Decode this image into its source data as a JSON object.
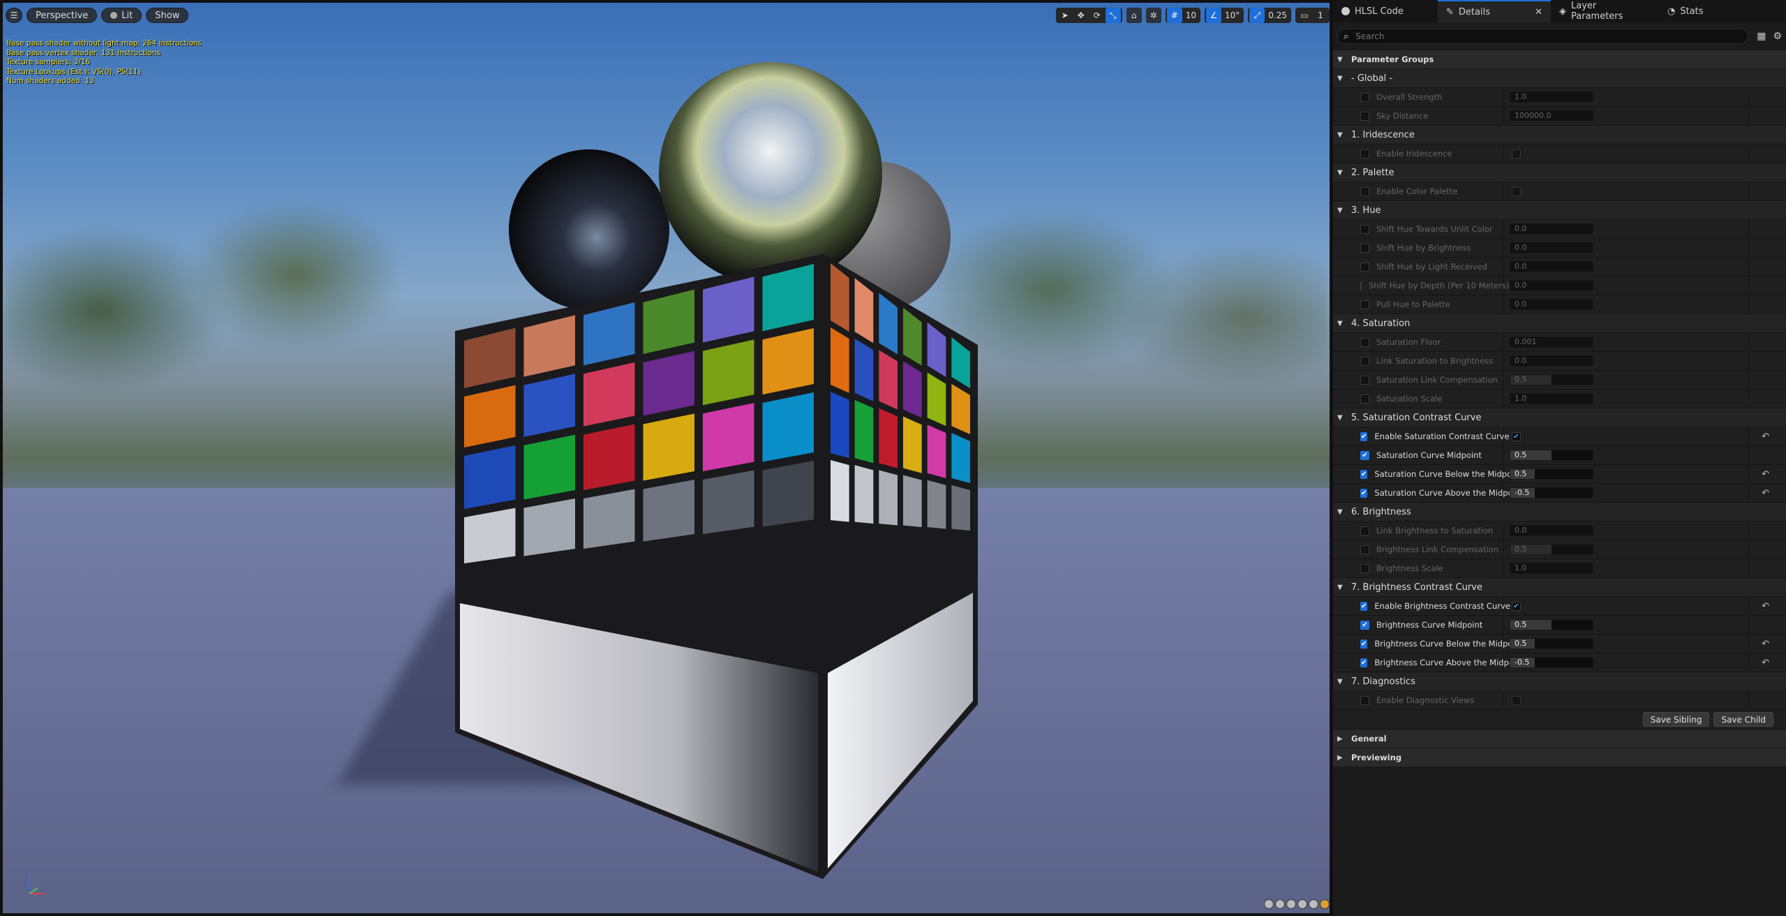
{
  "viewport": {
    "perspective_label": "Perspective",
    "lit_label": "Lit",
    "show_label": "Show",
    "grid_snap_value": "10",
    "rotation_snap_value": "10°",
    "scale_snap_value": "0.25",
    "camera_speed_value": "1",
    "stats": [
      "Base pass shader without light map: 264 instructions",
      "Base pass vertex shader: 131 instructions",
      "Texture samplers: 3/16",
      "Texture Lookups (Est.): VS(0), PS(11)",
      "Num shaders added: 13"
    ]
  },
  "tabs": [
    {
      "label": "HLSL Code",
      "icon": "ue-logo-icon"
    },
    {
      "label": "Details",
      "icon": "pencil-icon",
      "close": "✕"
    },
    {
      "label": "Layer Parameters",
      "icon": "layers-icon"
    },
    {
      "label": "Stats",
      "icon": "stats-icon"
    }
  ],
  "search": {
    "placeholder": "Search"
  },
  "details": {
    "parameter_groups": "Parameter Groups",
    "save_sibling": "Save Sibling",
    "save_child": "Save Child",
    "general": "General",
    "previewing": "Previewing",
    "groups": [
      {
        "name": "- Global -",
        "params": [
          {
            "label": "Overall Strength",
            "value": "1.0",
            "enabled": false,
            "fill": 0.0
          },
          {
            "label": "Sky Distance",
            "value": "100000.0",
            "enabled": false,
            "fill": 0.0
          }
        ]
      },
      {
        "name": "1. Iridescence",
        "params": [
          {
            "label": "Enable Iridescence",
            "bool": true,
            "enabled": false,
            "checked": false
          }
        ]
      },
      {
        "name": "2. Palette",
        "params": [
          {
            "label": "Enable Color Palette",
            "bool": true,
            "enabled": false,
            "checked": false
          }
        ]
      },
      {
        "name": "3. Hue",
        "params": [
          {
            "label": "Shift Hue Towards Unlit Color",
            "value": "0.0",
            "enabled": false,
            "fill": 0.0
          },
          {
            "label": "Shift Hue by Brightness",
            "value": "0.0",
            "enabled": false,
            "fill": 0.0
          },
          {
            "label": "Shift Hue by Light Received",
            "value": "0.0",
            "enabled": false,
            "fill": 0.0
          },
          {
            "label": "Shift Hue by Depth (Per 10 Meters)",
            "value": "0.0",
            "enabled": false,
            "fill": 0.0
          },
          {
            "label": "Pull Hue to Palette",
            "value": "0.0",
            "enabled": false,
            "fill": 0.0
          }
        ]
      },
      {
        "name": "4. Saturation",
        "params": [
          {
            "label": "Saturation Floor",
            "value": "0.001",
            "enabled": false,
            "fill": 0.0
          },
          {
            "label": "Link Saturation to Brightness",
            "value": "0.0",
            "enabled": false,
            "fill": 0.0
          },
          {
            "label": "Saturation Link Compensation",
            "value": "0.5",
            "enabled": false,
            "fill": 0.5
          },
          {
            "label": "Saturation Scale",
            "value": "1.0",
            "enabled": false,
            "fill": 0.0
          }
        ]
      },
      {
        "name": "5. Saturation Contrast Curve",
        "params": [
          {
            "label": "Enable Saturation Contrast Curve",
            "bool": true,
            "enabled": true,
            "checked": true,
            "reset": true
          },
          {
            "label": "Saturation Curve Midpoint",
            "value": "0.5",
            "enabled": true,
            "fill": 0.5,
            "reset": false
          },
          {
            "label": "Saturation Curve Below the Midpoint",
            "value": "0.5",
            "enabled": true,
            "fill": 0.3,
            "reset": true
          },
          {
            "label": "Saturation Curve Above the Midpoint",
            "value": "-0.5",
            "enabled": true,
            "fill": 0.3,
            "reset": true
          }
        ]
      },
      {
        "name": "6. Brightness",
        "params": [
          {
            "label": "Link Brightness to Saturation",
            "value": "0.0",
            "enabled": false,
            "fill": 0.0
          },
          {
            "label": "Brightness Link Compensation",
            "value": "0.5",
            "enabled": false,
            "fill": 0.5
          },
          {
            "label": "Brightness Scale",
            "value": "1.0",
            "enabled": false,
            "fill": 0.0
          }
        ]
      },
      {
        "name": "7. Brightness Contrast Curve",
        "params": [
          {
            "label": "Enable Brightness Contrast Curve",
            "bool": true,
            "enabled": true,
            "checked": true,
            "reset": true
          },
          {
            "label": "Brightness Curve Midpoint",
            "value": "0.5",
            "enabled": true,
            "fill": 0.5,
            "reset": false
          },
          {
            "label": "Brightness Curve Below the Midpoint",
            "value": "0.5",
            "enabled": true,
            "fill": 0.3,
            "reset": true
          },
          {
            "label": "Brightness Curve Above the Midpoint",
            "value": "-0.5",
            "enabled": true,
            "fill": 0.3,
            "reset": true
          }
        ]
      },
      {
        "name": "7. Diagnostics",
        "params": [
          {
            "label": "Enable Diagnostic Views",
            "bool": true,
            "enabled": false,
            "checked": false
          }
        ]
      }
    ]
  },
  "colors": {
    "accent": "#1e6fd9",
    "stats_text": "#e6d52c",
    "panel_bg": "#1b1b1b"
  }
}
